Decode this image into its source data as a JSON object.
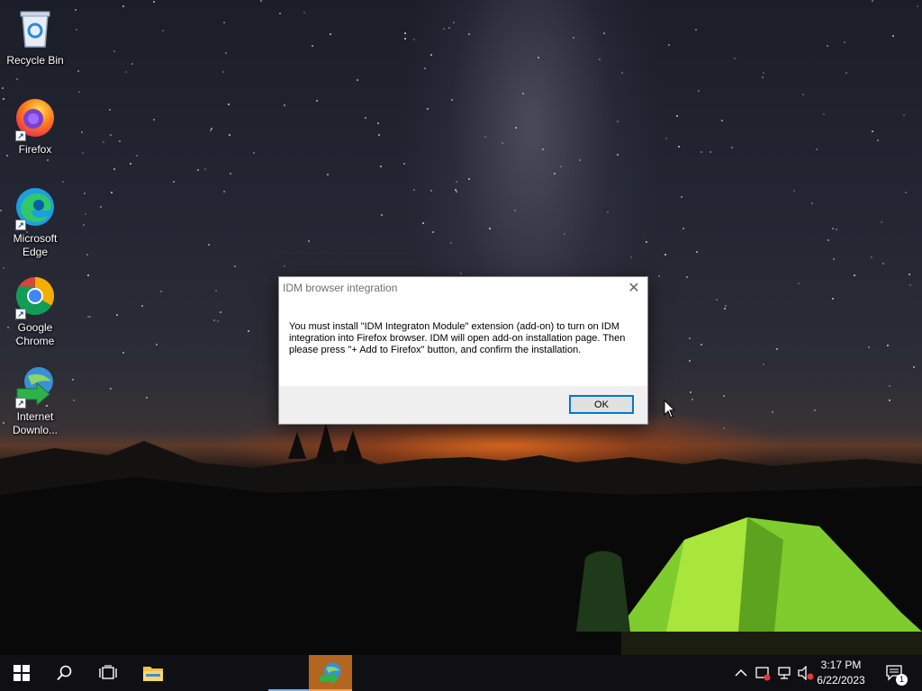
{
  "desktop": {
    "icons": [
      {
        "label": "Recycle Bin",
        "icon": "recycle-bin-icon"
      },
      {
        "label": "Firefox",
        "icon": "firefox-icon"
      },
      {
        "label": "Microsoft Edge",
        "icon": "edge-icon"
      },
      {
        "label": "Google Chrome",
        "icon": "chrome-icon"
      },
      {
        "label": "Internet Downlo...",
        "icon": "idm-icon"
      }
    ]
  },
  "dialog": {
    "title": "IDM browser integration",
    "message": "You must install \"IDM Integraton Module\" extension (add-on) to turn on IDM integration into Firefox browser. IDM will open add-on installation page. Then please press \"+ Add to Firefox\" button, and confirm the installation.",
    "ok_label": "OK",
    "close_glyph": "✕"
  },
  "taskbar": {
    "buttons": [
      "start-icon",
      "search-icon",
      "task-view-icon",
      "file-explorer-icon",
      "idm-taskbar-icon"
    ],
    "clock": {
      "time": "3:17 PM",
      "date": "6/22/2023"
    },
    "notification_count": "1",
    "colors": {
      "taskbar_bg": "#101014",
      "active_app": "#b3661f",
      "accent": "#0078d7"
    }
  }
}
